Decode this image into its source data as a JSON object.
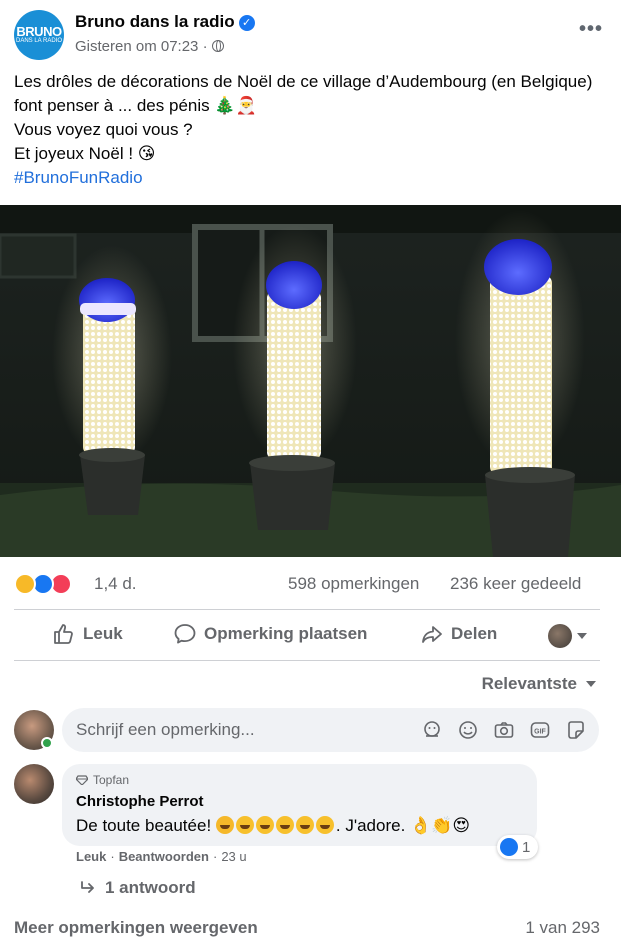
{
  "header": {
    "logo_line1": "BRUNO",
    "logo_line2": "DANS LA RADIO",
    "page_name": "Bruno dans la radio",
    "timestamp": "Gisteren om 07:23 ·"
  },
  "post": {
    "lines": [
      "Les drôles de décorations de Noël de ce village d’Audembourg (en Belgique) font penser à ... des pénis 🎄🎅",
      "Vous voyez quoi vous ?",
      "Et joyeux Noël ! 😘"
    ],
    "hashtag": "#BrunoFunRadio"
  },
  "stats": {
    "reaction_count": "1,4 d.",
    "comments": "598 opmerkingen",
    "shares": "236 keer gedeeld"
  },
  "actions": {
    "like": "Leuk",
    "comment": "Opmerking plaatsen",
    "share": "Delen"
  },
  "sort": {
    "label": "Relevantste"
  },
  "composer": {
    "placeholder": "Schrijf een opmerking..."
  },
  "comment": {
    "badge": "Topfan",
    "author": "Christophe Perrot",
    "text_start": "De toute beautée!",
    "text_middle": ". J'adore.",
    "text_end": "👌👏😍",
    "reaction_count": "1",
    "like": "Leuk",
    "sep": "·",
    "reply": "Beantwoorden",
    "time": "23 u",
    "replies": "1 antwoord"
  },
  "footer": {
    "more_comments": "Meer opmerkingen weergeven",
    "pagination": "1 van 293"
  },
  "colors": {
    "accent": "#1877f2",
    "text_secondary": "#65676b",
    "hashtag": "#216fdb",
    "bubble": "#f0f2f5"
  }
}
